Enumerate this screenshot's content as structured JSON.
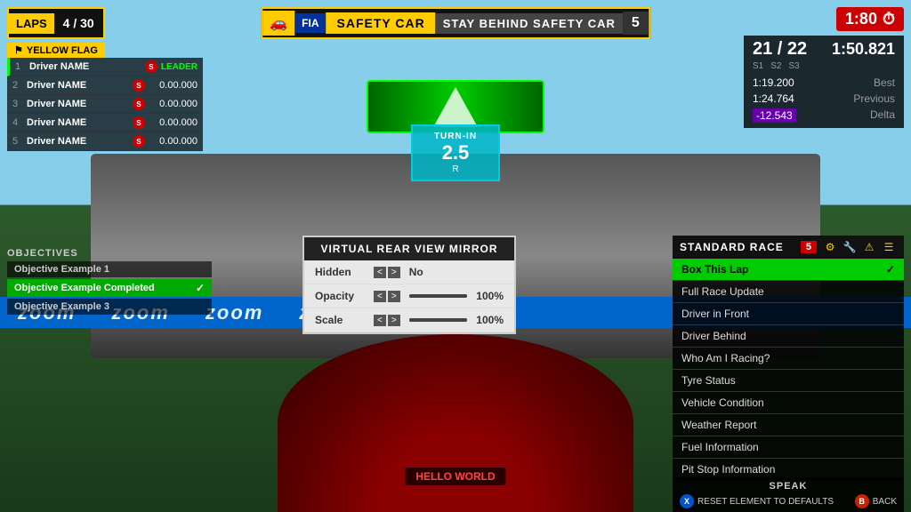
{
  "background": {
    "sky_color": "#87CEEB",
    "track_color": "#666"
  },
  "timer": {
    "value": "1:80",
    "icon": "⏱"
  },
  "safety_car": {
    "car_icon": "🚗",
    "fia_label": "FIA",
    "label": "SAFETY CAR",
    "message": "STAY BEHIND SAFETY CAR",
    "number": "5"
  },
  "laps": {
    "label": "LAPS",
    "current": "4",
    "total": "30",
    "display": "4 / 30"
  },
  "yellow_flag": {
    "icon": "⚑",
    "label": "YELLOW FLAG"
  },
  "drivers": [
    {
      "pos": "1",
      "name": "Driver NAME",
      "time": "LEADER",
      "is_leader": true
    },
    {
      "pos": "2",
      "name": "Driver NAME",
      "time": "0.00.000"
    },
    {
      "pos": "3",
      "name": "Driver NAME",
      "time": "0.00.000"
    },
    {
      "pos": "4",
      "name": "Driver NAME",
      "time": "0.00.000"
    },
    {
      "pos": "5",
      "name": "Driver NAME",
      "time": "0.00.000"
    }
  ],
  "race_info": {
    "position": "21 / 22",
    "lap_time": "1:50.821",
    "s1_label": "S1",
    "s2_label": "S2",
    "s3_label": "S3",
    "best_time": "1:19.200",
    "best_label": "Best",
    "previous_time": "1:24.764",
    "previous_label": "Previous",
    "delta_time": "-12.543",
    "delta_label": "Delta"
  },
  "turn_in": {
    "label": "TURN-IN",
    "value": "2.5",
    "r_label": "R"
  },
  "objectives": {
    "title": "OBJECTIVES",
    "items": [
      {
        "label": "Objective Example 1",
        "completed": false
      },
      {
        "label": "Objective Example Completed",
        "completed": true
      },
      {
        "label": "Objective Example 3",
        "completed": false
      }
    ]
  },
  "mirror_panel": {
    "title": "VIRTUAL REAR VIEW MIRROR",
    "hidden_label": "Hidden",
    "hidden_arrows": "<>",
    "hidden_value": "No",
    "opacity_label": "Opacity",
    "opacity_arrows": "<>",
    "opacity_value": "100%",
    "scale_label": "Scale",
    "scale_arrows": "<>",
    "scale_value": "100%"
  },
  "right_panel": {
    "title": "STANDARD RACE",
    "badge": "5",
    "icons": [
      "⚙",
      "🔧",
      "⚠",
      "☰"
    ],
    "menu_items": [
      {
        "label": "Box This Lap",
        "active": true
      },
      {
        "label": "Full Race Update",
        "active": false
      },
      {
        "label": "Driver in Front",
        "active": false
      },
      {
        "label": "Driver Behind",
        "active": false
      },
      {
        "label": "Who Am I Racing?",
        "active": false
      },
      {
        "label": "Tyre Status",
        "active": false
      },
      {
        "label": "Vehicle Condition",
        "active": false
      },
      {
        "label": "Weather Report",
        "active": false
      },
      {
        "label": "Fuel Information",
        "active": false
      },
      {
        "label": "Pit Stop Information",
        "active": false
      }
    ]
  },
  "bottom_bar": {
    "speak_label": "SPEAK",
    "reset_label": "RESET ELEMENT TO DEFAULTS",
    "back_label": "BACK",
    "x_btn": "X",
    "b_btn": "B"
  },
  "hello_bar": {
    "text": "HELLO WORLD"
  },
  "zoom_banners": [
    "zoom",
    "zoom",
    "zoom",
    "zoom",
    "zoom"
  ]
}
